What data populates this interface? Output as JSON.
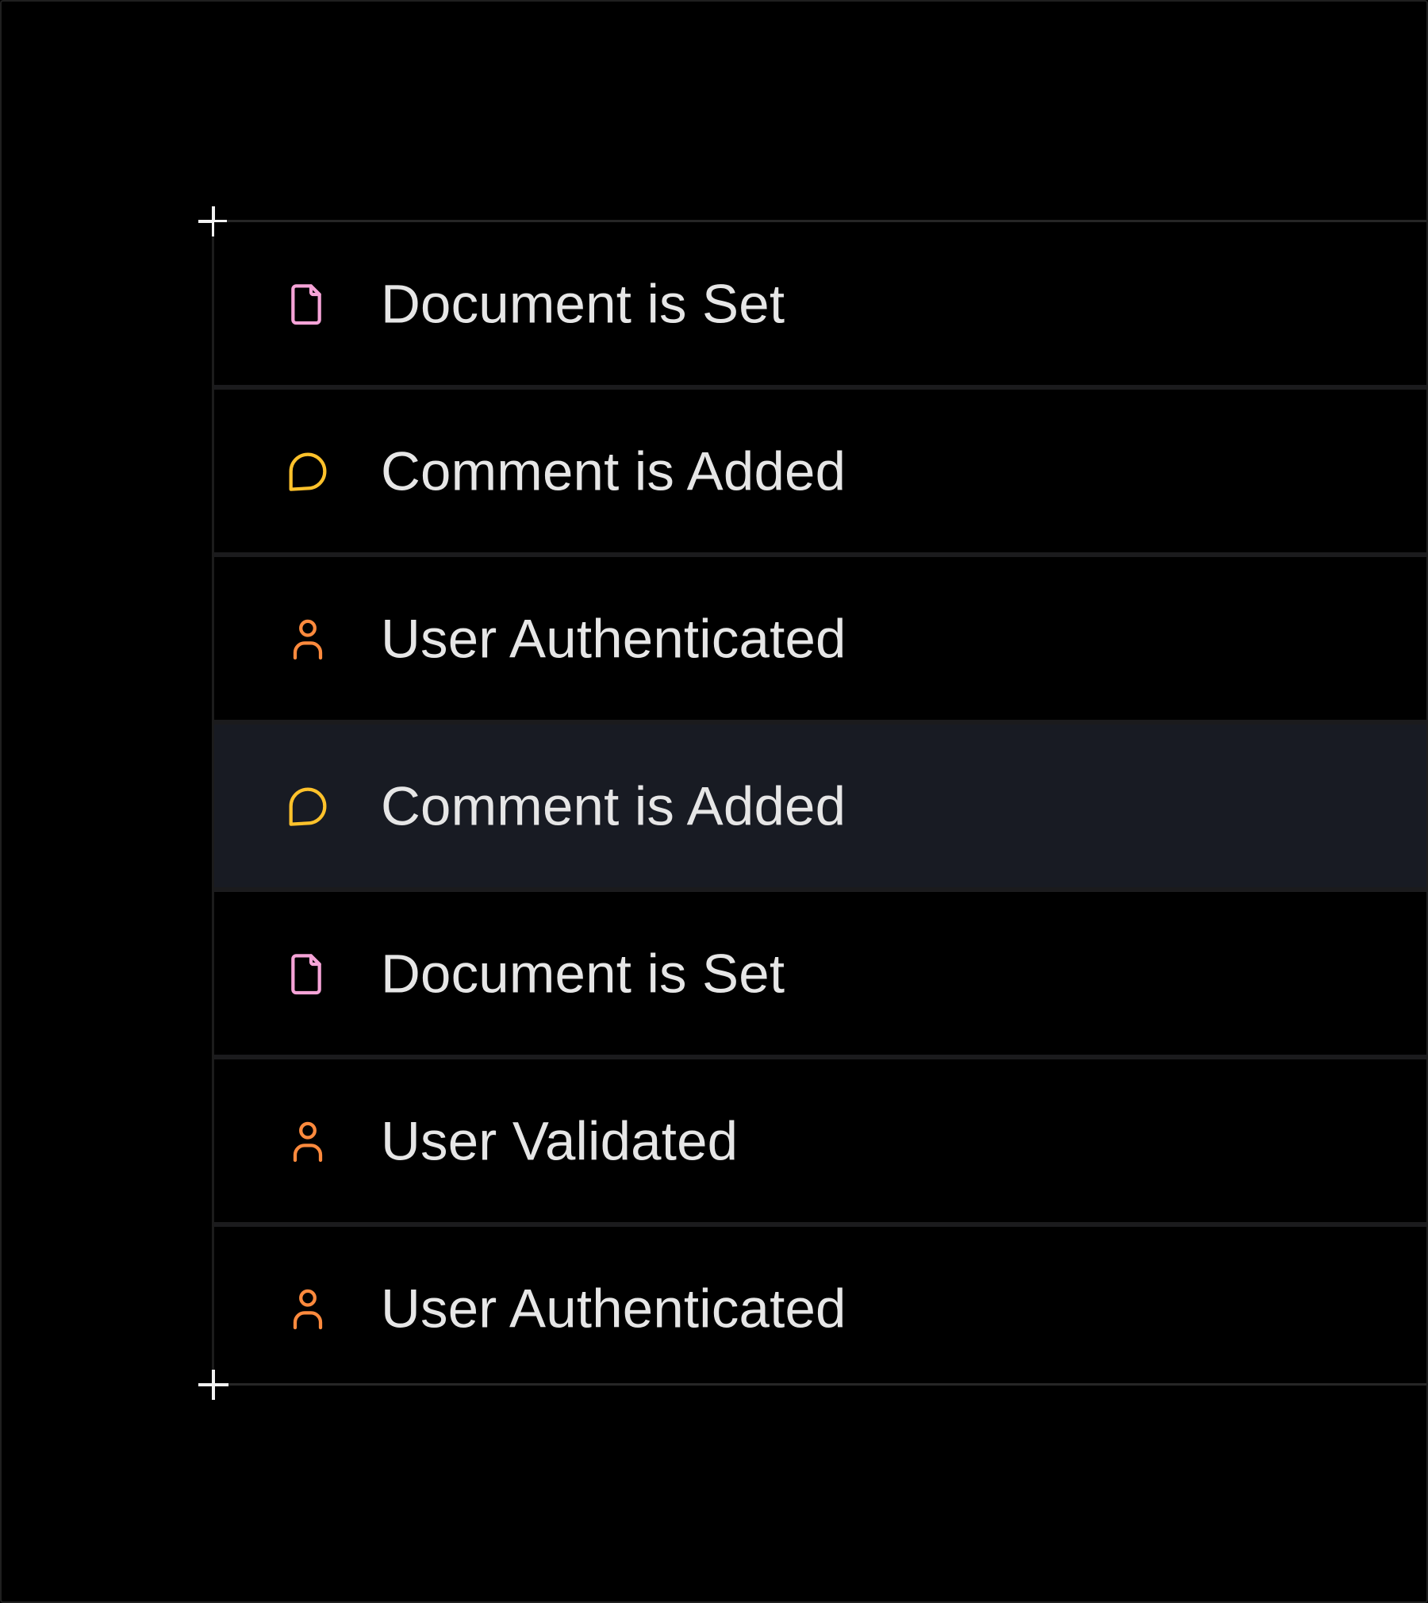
{
  "colors": {
    "document": "#f5a3d7",
    "comment": "#ffc22b",
    "user": "#ff8a3d",
    "text": "#e6e6e6",
    "highlight_row": "#181b23"
  },
  "events": [
    {
      "label": "Document is Set",
      "icon": "document-icon",
      "kind": "document",
      "highlighted": false
    },
    {
      "label": "Comment is Added",
      "icon": "comment-icon",
      "kind": "comment",
      "highlighted": false
    },
    {
      "label": "User Authenticated",
      "icon": "user-icon",
      "kind": "user",
      "highlighted": false
    },
    {
      "label": "Comment is Added",
      "icon": "comment-icon",
      "kind": "comment",
      "highlighted": true
    },
    {
      "label": "Document is Set",
      "icon": "document-icon",
      "kind": "document",
      "highlighted": false
    },
    {
      "label": "User Validated",
      "icon": "user-icon",
      "kind": "user",
      "highlighted": false
    },
    {
      "label": "User Authenticated",
      "icon": "user-icon",
      "kind": "user",
      "highlighted": false
    }
  ]
}
